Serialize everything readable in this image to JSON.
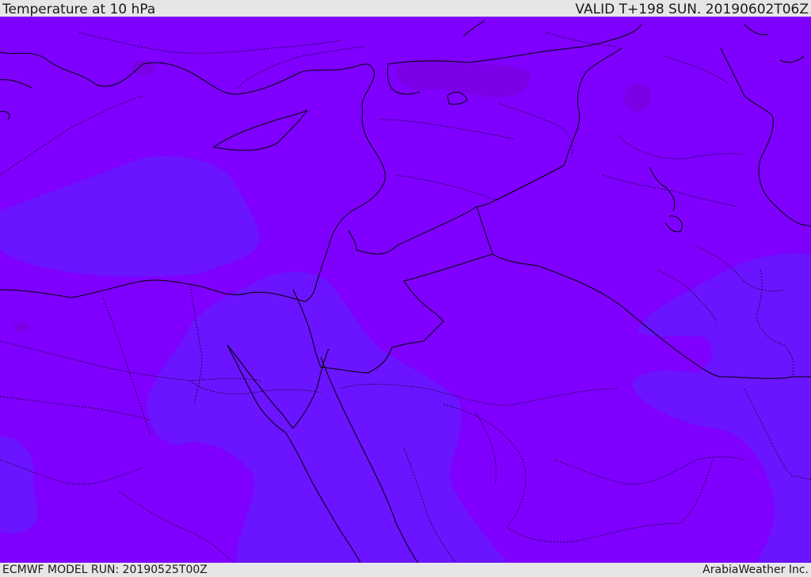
{
  "header": {
    "title": "Temperature at 10 hPa",
    "valid": "VALID T+198 SUN. 20190602T06Z"
  },
  "footer": {
    "model_run": "ECMWF MODEL RUN: 20190525T00Z",
    "credit": "ArabiaWeather Inc."
  },
  "colors": {
    "base_field": "#7f00ff",
    "cool_field": "#6a14ff",
    "warm_spot": "#7a00e6",
    "border_line": "#000000"
  }
}
